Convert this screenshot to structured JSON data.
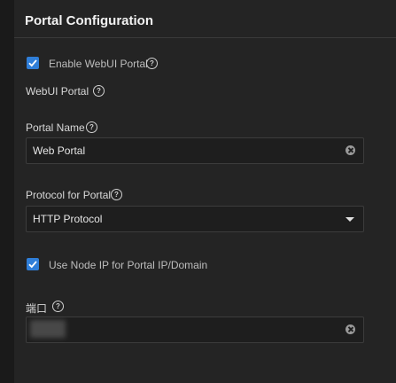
{
  "section": {
    "title": "Portal Configuration"
  },
  "enable_webui": {
    "label": "Enable WebUI Portal",
    "checked": true,
    "help_icon": "?"
  },
  "webui_portal": {
    "label": "WebUI Portal",
    "help_icon": "?"
  },
  "portal_name": {
    "label": "Portal Name",
    "value": "Web Portal",
    "help_icon": "?"
  },
  "protocol": {
    "label": "Protocol for Portal",
    "selected": "HTTP Protocol",
    "help_icon": "?"
  },
  "use_node_ip": {
    "label": "Use Node IP for Portal IP/Domain",
    "checked": true
  },
  "port": {
    "label": "端口",
    "value": "",
    "help_icon": "?"
  },
  "colors": {
    "accent": "#2f7ed8",
    "background": "#242424"
  }
}
